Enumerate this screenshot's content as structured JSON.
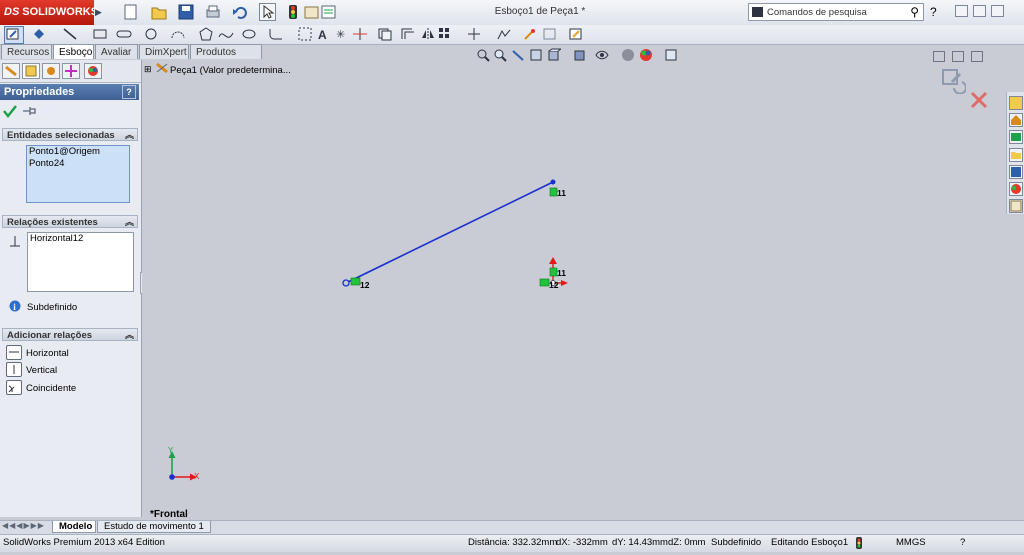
{
  "app": {
    "logo_text": "SOLIDWORKS",
    "logo_prefix": "DS",
    "document_title": "Esboço1 de Peça1 *",
    "search_placeholder": "Comandos de pesquisa"
  },
  "tabs": [
    {
      "label": "Recursos",
      "active": false
    },
    {
      "label": "Esboço",
      "active": true
    },
    {
      "label": "Avaliar",
      "active": false
    },
    {
      "label": "DimXpert",
      "active": false
    },
    {
      "label": "Produtos Office",
      "active": false
    }
  ],
  "tree": {
    "part_label": "Peça1  (Valor predetermina..."
  },
  "property_manager": {
    "title": "Propriedades",
    "help": "?",
    "selected_entities": {
      "header": "Entidades selecionadas",
      "items": [
        "Ponto1@Origem",
        "Ponto24"
      ]
    },
    "existing_relations": {
      "header": "Relações existentes",
      "items": [
        "Horizontal12"
      ],
      "status": "Subdefinido"
    },
    "add_relations": {
      "header": "Adicionar relações",
      "items": [
        "Horizontal",
        "Vertical",
        "Coincidente"
      ]
    }
  },
  "graphics": {
    "view_label": "*Frontal",
    "relation_tag_1": "11",
    "relation_tag_2": "12",
    "relation_tag_3": "11",
    "relation_tag_4": "12",
    "axis_x": "X",
    "axis_y": "Y",
    "line_color": "#1a2fd0",
    "relation_color": "#1fc43a"
  },
  "bottom_tabs": [
    {
      "label": "Modelo",
      "active": true
    },
    {
      "label": "Estudo de movimento 1",
      "active": false
    }
  ],
  "status": {
    "edition": "SolidWorks Premium 2013 x64 Edition",
    "distance": "Distância: 332.32mm",
    "dx": "dX: -332mm",
    "dy": "dY: 14.43mm",
    "dz": "dZ: 0mm",
    "state": "Subdefinido",
    "editing": "Editando Esboço1",
    "units": "MMGS",
    "help": "?"
  }
}
